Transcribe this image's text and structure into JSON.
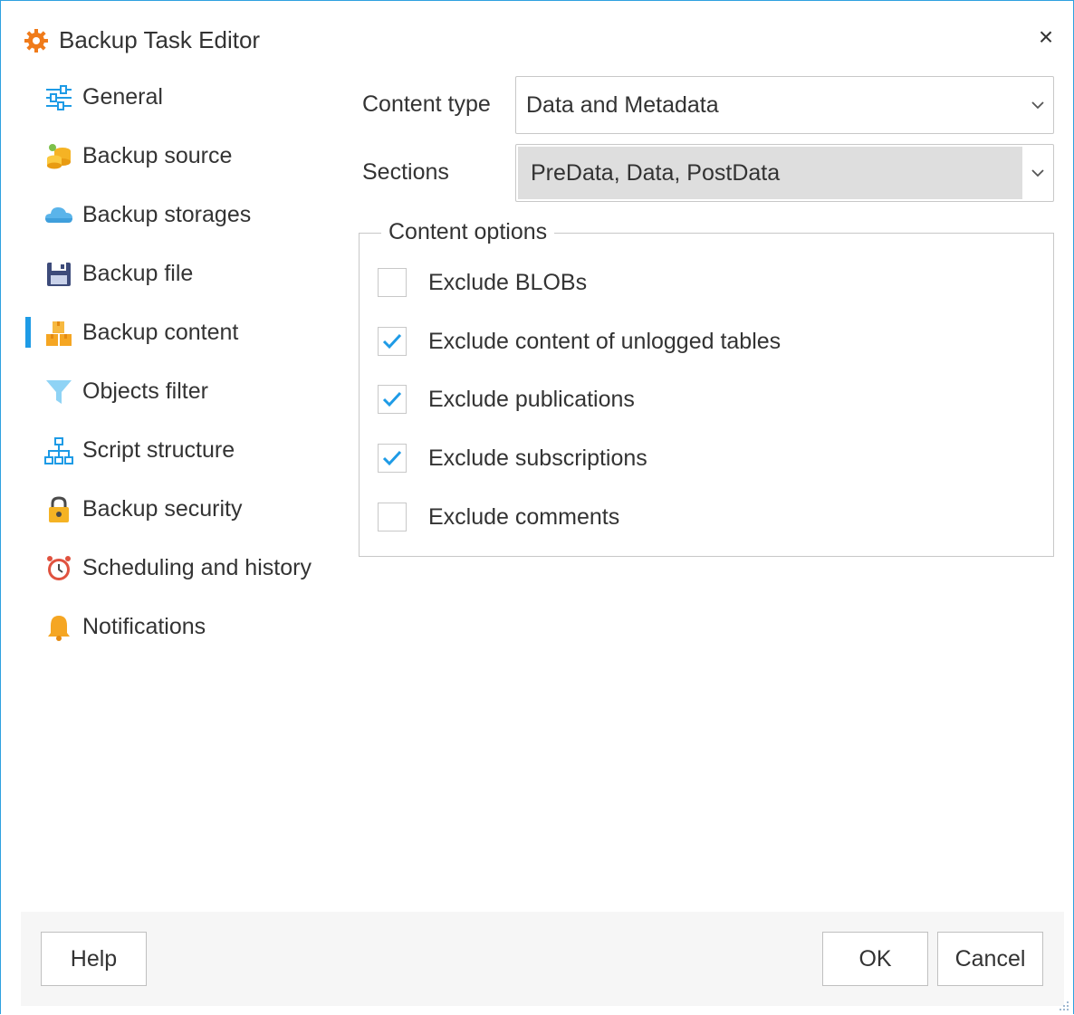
{
  "window": {
    "title": "Backup Task Editor",
    "close_symbol": "×",
    "accent": "#1e9be6"
  },
  "nav": {
    "items": [
      {
        "label": "General",
        "icon": "sliders-icon",
        "active": false
      },
      {
        "label": "Backup source",
        "icon": "coins-icon",
        "active": false
      },
      {
        "label": "Backup storages",
        "icon": "cloud-icon",
        "active": false
      },
      {
        "label": "Backup file",
        "icon": "floppy-disk-icon",
        "active": false
      },
      {
        "label": "Backup content",
        "icon": "boxes-icon",
        "active": true
      },
      {
        "label": "Objects filter",
        "icon": "funnel-icon",
        "active": false
      },
      {
        "label": "Script structure",
        "icon": "hierarchy-icon",
        "active": false
      },
      {
        "label": "Backup security",
        "icon": "padlock-icon",
        "active": false
      },
      {
        "label": "Scheduling and history",
        "icon": "alarm-clock-icon",
        "active": false
      },
      {
        "label": "Notifications",
        "icon": "bell-icon",
        "active": false
      }
    ]
  },
  "content": {
    "content_type": {
      "label": "Content type",
      "value": "Data and Metadata"
    },
    "sections": {
      "label": "Sections",
      "value": "PreData, Data, PostData"
    },
    "options_group": {
      "legend": "Content options",
      "options": [
        {
          "label": "Exclude BLOBs",
          "checked": false
        },
        {
          "label": "Exclude content of unlogged tables",
          "checked": true
        },
        {
          "label": "Exclude publications",
          "checked": true
        },
        {
          "label": "Exclude subscriptions",
          "checked": true
        },
        {
          "label": "Exclude comments",
          "checked": false
        }
      ]
    }
  },
  "footer": {
    "help_label": "Help",
    "ok_label": "OK",
    "cancel_label": "Cancel"
  }
}
